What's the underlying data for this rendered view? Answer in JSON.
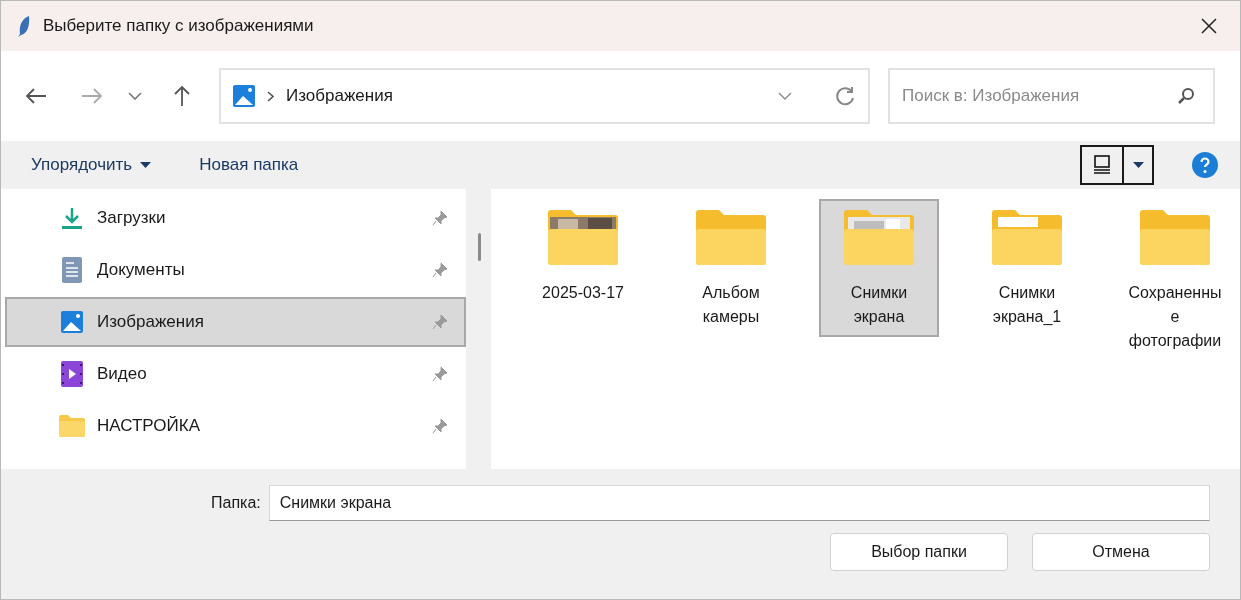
{
  "window": {
    "title": "Выберите папку с изображениями"
  },
  "address": {
    "path": "Изображения"
  },
  "search": {
    "placeholder": "Поиск в: Изображения"
  },
  "toolbar": {
    "organize": "Упорядочить",
    "new_folder": "Новая папка"
  },
  "sidebar": {
    "items": [
      {
        "label": "Загрузки",
        "kind": "download",
        "selected": false
      },
      {
        "label": "Документы",
        "kind": "document",
        "selected": false
      },
      {
        "label": "Изображения",
        "kind": "pictures",
        "selected": true
      },
      {
        "label": "Видео",
        "kind": "video",
        "selected": false
      },
      {
        "label": "НАСТРОЙКА",
        "kind": "folder",
        "selected": false
      }
    ]
  },
  "folders": [
    {
      "name": "2025-03-17",
      "kind": "photo",
      "selected": false
    },
    {
      "name": "Альбом камеры",
      "kind": "plain",
      "selected": false
    },
    {
      "name": "Снимки экрана",
      "kind": "screens",
      "selected": true
    },
    {
      "name": "Снимки экрана_1",
      "kind": "files",
      "selected": false
    },
    {
      "name": "Сохраненные фотографии",
      "kind": "plain",
      "selected": false
    }
  ],
  "footer": {
    "label": "Папка:",
    "value": "Снимки экрана",
    "buttons": [
      "Выбор папки",
      "Отмена"
    ]
  }
}
